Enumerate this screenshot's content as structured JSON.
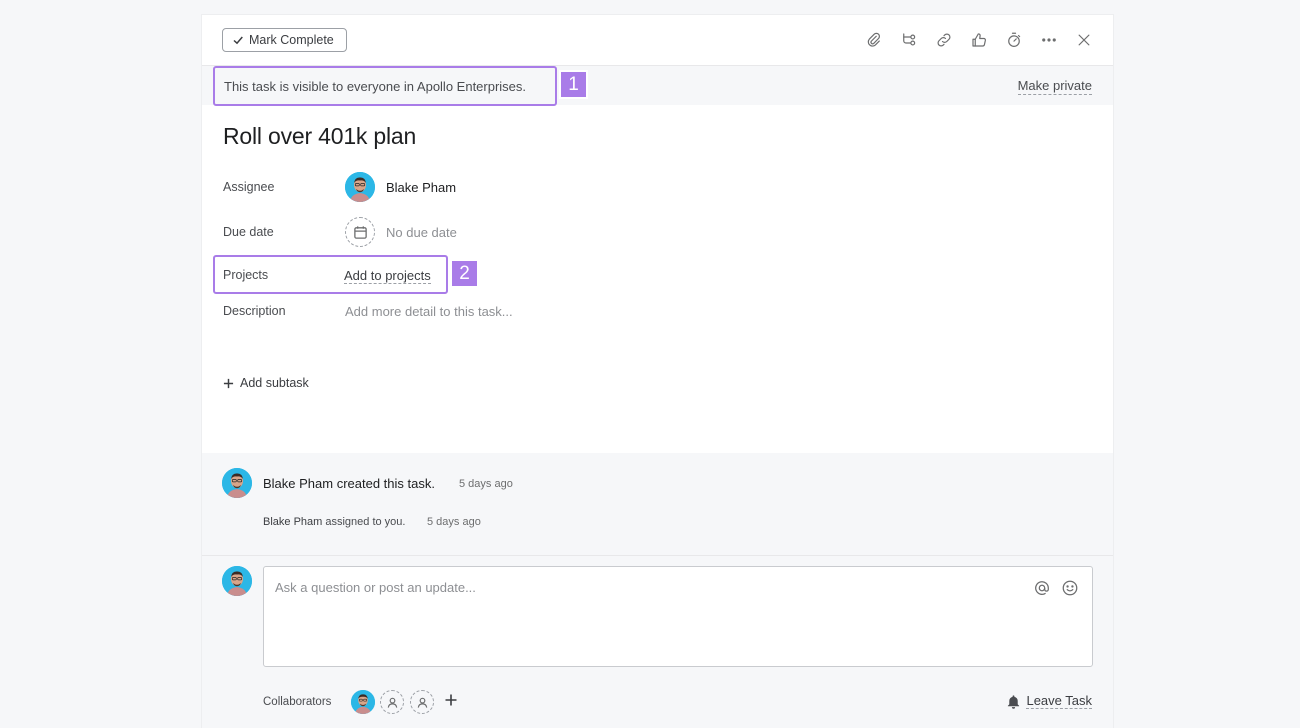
{
  "toolbar": {
    "mark_complete_label": "Mark Complete",
    "icons": [
      "attachment-icon",
      "subtask-icon",
      "link-icon",
      "like-icon",
      "timer-icon",
      "more-icon",
      "close-icon"
    ]
  },
  "banner": {
    "text": "This task is visible to everyone in Apollo Enterprises.",
    "make_private_label": "Make private",
    "badge_1": "1"
  },
  "task": {
    "title": "Roll over 401k plan",
    "fields": {
      "assignee_label": "Assignee",
      "assignee_name": "Blake Pham",
      "due_label": "Due date",
      "due_value": "No due date",
      "projects_label": "Projects",
      "projects_link": "Add to projects",
      "badge_2": "2",
      "description_label": "Description",
      "description_placeholder": "Add more detail to this task..."
    },
    "add_subtask_label": "Add subtask"
  },
  "activity": {
    "line1": "Blake Pham created this task.",
    "time1": "5 days ago",
    "line2_who": "Blake Pham",
    "line2_rest": " assigned to you.",
    "time2": "5 days ago"
  },
  "comment": {
    "placeholder": "Ask a question or post an update...",
    "collaborators_label": "Collaborators",
    "leave_task_label": "Leave Task"
  },
  "colors": {
    "accent_highlight": "#a97ce8",
    "avatar_bg": "#2cb7e6"
  }
}
